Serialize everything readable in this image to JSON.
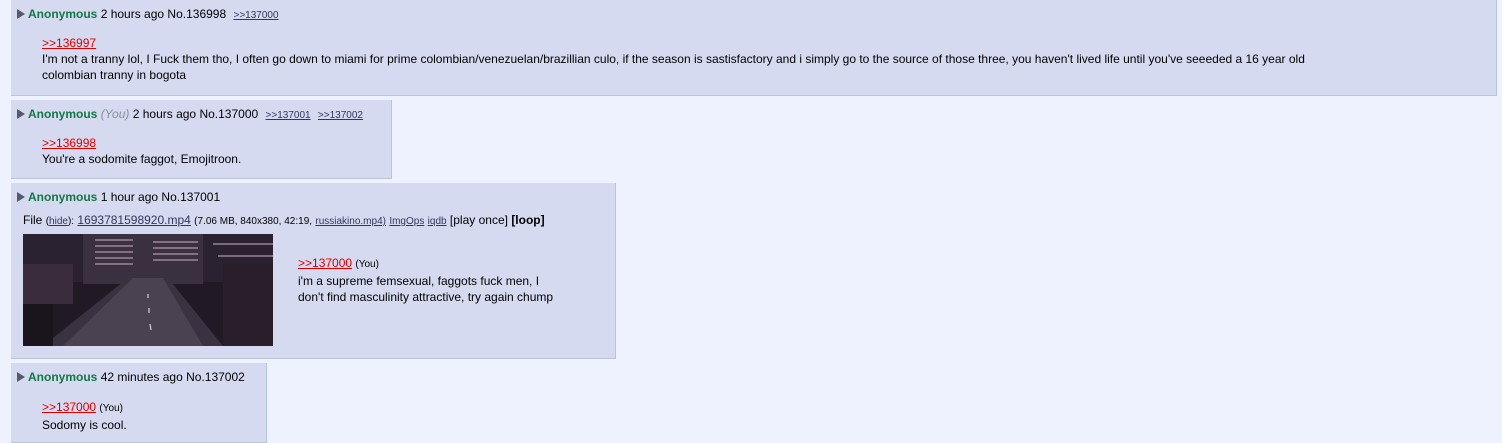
{
  "posts": [
    {
      "name": "Anonymous",
      "time": "2 hours ago",
      "no": "No.136998",
      "backlinks": [
        ">>137000"
      ],
      "quote": ">>136997",
      "text_line1": "I'm not a tranny lol, I Fuck them tho, I often go down to miami for prime colombian/venezuelan/brazillian culo, if the season is sastisfactory and i simply go to the source of those three, you haven't lived life until you've seeeded a 16 year old",
      "text_line2": "colombian tranny in bogota"
    },
    {
      "name": "Anonymous",
      "you": "(You)",
      "time": "2 hours ago",
      "no": "No.137000",
      "backlinks": [
        ">>137001",
        ">>137002"
      ],
      "quote": ">>136998",
      "text": "You're a sodomite faggot, Emojitroon."
    },
    {
      "name": "Anonymous",
      "time": "1 hour ago",
      "no": "No.137001",
      "file": {
        "label": "File",
        "hide": "hide",
        "filename": "1693781598920.mp4",
        "meta": "(7.06 MB, 840x380, 42:19,",
        "source": "russiakino.mp4)",
        "imgops": "ImgOps",
        "iqdb": "iqdb",
        "play": "[play once]",
        "loop": "[loop]"
      },
      "quote": ">>137000",
      "quote_you": "(You)",
      "text_line1": "i'm a supreme femsexual, faggots fuck men, I",
      "text_line2": "don't find masculinity attractive, try again chump"
    },
    {
      "name": "Anonymous",
      "time": "42 minutes ago",
      "no": "No.137002",
      "quote": ">>137000",
      "quote_you": "(You)",
      "text": "Sodomy is cool."
    }
  ],
  "colors": {
    "background": "#eef2ff",
    "post": "#d6daf0",
    "name": "#117743",
    "quotelink": "#dd0000"
  }
}
